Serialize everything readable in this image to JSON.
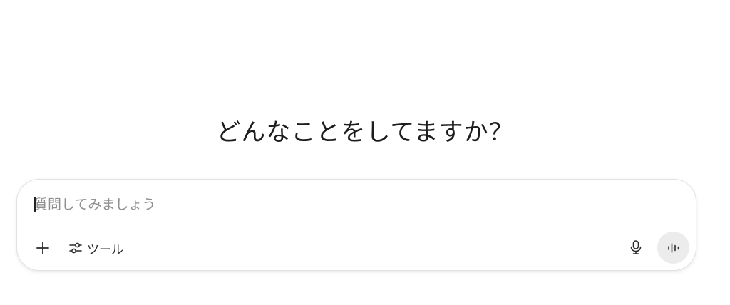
{
  "headline": "どんなことをしてますか？",
  "composer": {
    "placeholder": "質問してみましょう",
    "value": "",
    "tools_label": "ツール"
  },
  "icons": {
    "add": "plus-icon",
    "tools": "sliders-icon",
    "mic": "microphone-icon",
    "voice": "voice-waveform-icon"
  },
  "colors": {
    "background": "#ffffff",
    "text": "#1c1c1c",
    "placeholder": "#8f8f8f",
    "composer_border": "#e2e2e2",
    "voice_button_bg": "#ececec"
  }
}
